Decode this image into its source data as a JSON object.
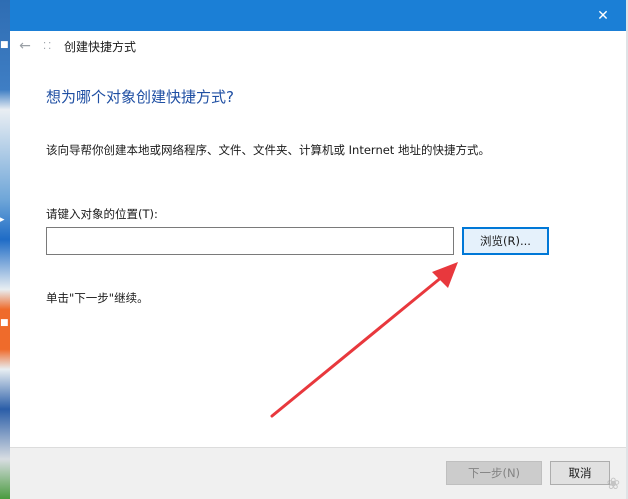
{
  "window": {
    "header_title": "创建快捷方式",
    "close_glyph": "✕",
    "back_glyph": "←"
  },
  "content": {
    "heading": "想为哪个对象创建快捷方式?",
    "description": "该向导帮你创建本地或网络程序、文件、文件夹、计算机或 Internet 地址的快捷方式。",
    "location_label": "请键入对象的位置(T):",
    "location_value": "",
    "browse_label": "浏览(R)...",
    "hint": "单击\"下一步\"继续。"
  },
  "footer": {
    "next_label": "下一步(N)",
    "cancel_label": "取消"
  },
  "annotation": {
    "arrow_color": "#e8383d"
  },
  "colors": {
    "titlebar": "#1b7fd6",
    "heading": "#1f4fa3",
    "browse_border": "#0078d7"
  }
}
